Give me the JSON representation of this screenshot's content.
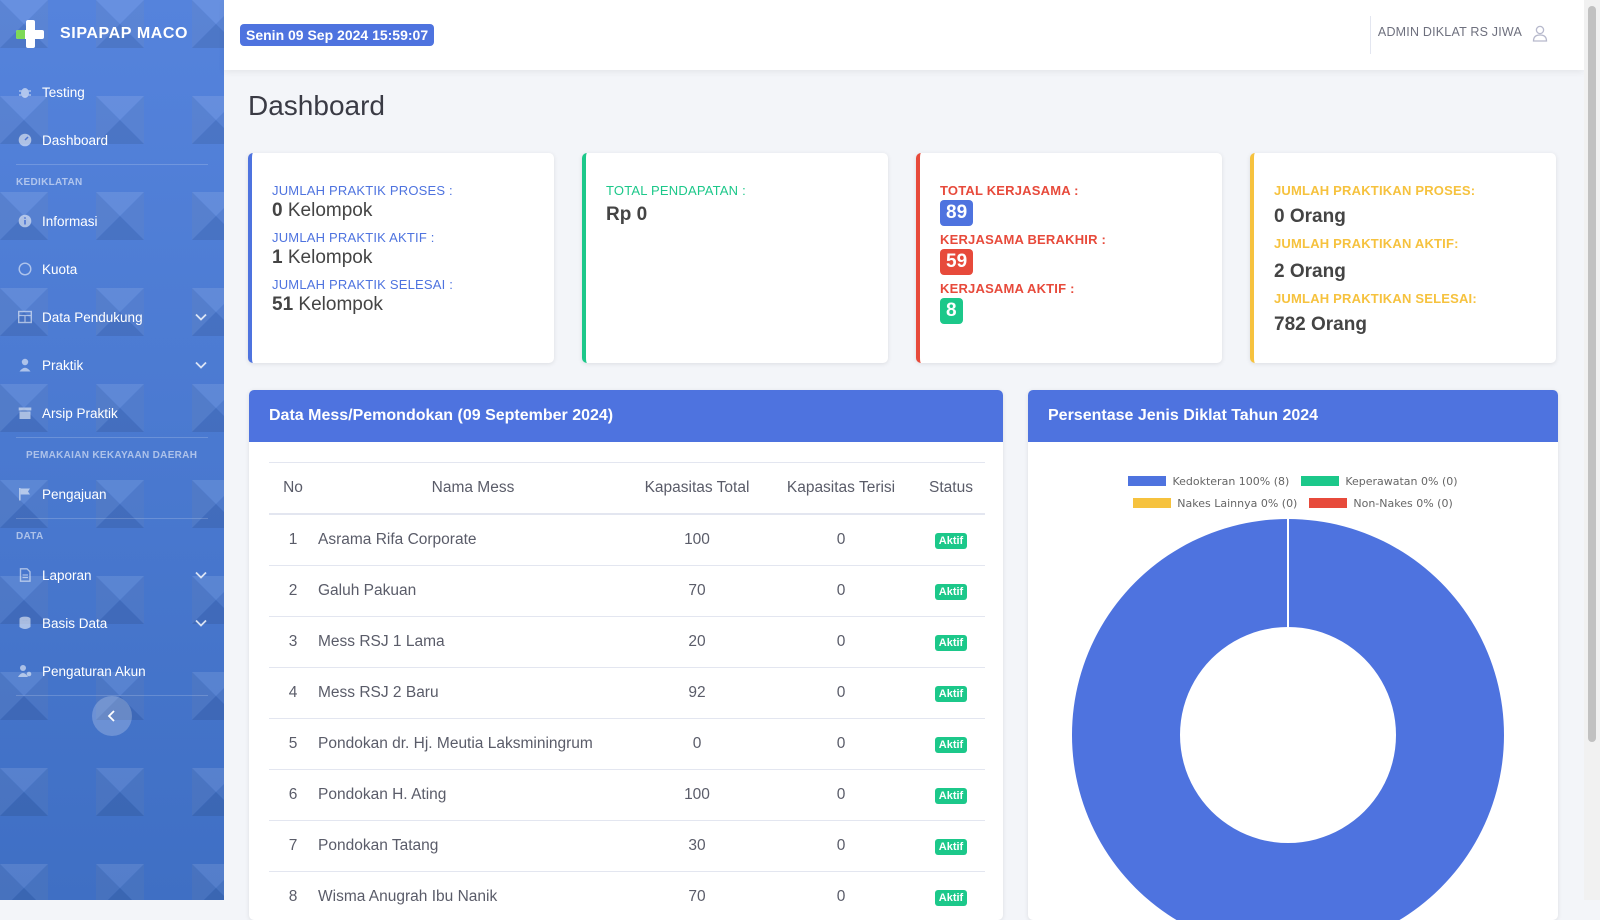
{
  "brand": {
    "name": "SIPAPAP MACO"
  },
  "sidebar": {
    "items": [
      {
        "label": "Testing"
      },
      {
        "label": "Dashboard"
      },
      {
        "label": "Informasi"
      },
      {
        "label": "Kuota"
      },
      {
        "label": "Data Pendukung"
      },
      {
        "label": "Praktik"
      },
      {
        "label": "Arsip Praktik"
      },
      {
        "label": "Pengajuan"
      },
      {
        "label": "Laporan"
      },
      {
        "label": "Basis Data"
      },
      {
        "label": "Pengaturan Akun"
      }
    ],
    "headings": {
      "kediklatan": "KEDIKLATAN",
      "pemakaian": "PEMAKAIAN KEKAYAAN DAERAH",
      "data": "DATA"
    }
  },
  "topbar": {
    "datetime": "Senin 09 Sep 2024 15:59:07",
    "user": "ADMIN DIKLAT RS JIWA"
  },
  "page": {
    "title": "Dashboard"
  },
  "cards": {
    "praktik": {
      "proses_label": "JUMLAH PRAKTIK PROSES :",
      "proses_num": "0",
      "proses_unit": " Kelompok",
      "aktif_label": "JUMLAH PRAKTIK AKTIF :",
      "aktif_num": "1",
      "aktif_unit": " Kelompok",
      "selesai_label": "JUMLAH PRAKTIK SELESAI :",
      "selesai_num": "51",
      "selesai_unit": " Kelompok"
    },
    "pendapatan": {
      "label": "TOTAL PENDAPATAN :",
      "value": "Rp 0"
    },
    "kerjasama": {
      "total_label": "TOTAL KERJASAMA :",
      "total": "89",
      "berakhir_label": "KERJASAMA BERAKHIR :",
      "berakhir": "59",
      "aktif_label": "KERJASAMA AKTIF :",
      "aktif": "8"
    },
    "praktikan": {
      "proses_label": "JUMLAH PRAKTIKAN PROSES:",
      "proses": "0 Orang",
      "aktif_label": "JUMLAH PRAKTIKAN AKTIF:",
      "aktif": "2 Orang",
      "selesai_label": "JUMLAH PRAKTIKAN SELESAI:",
      "selesai": "782 Orang"
    }
  },
  "mess": {
    "title": "Data Mess/Pemondokan (09 September 2024)",
    "columns": [
      "No",
      "Nama Mess",
      "Kapasitas Total",
      "Kapasitas Terisi",
      "Status"
    ],
    "rows": [
      {
        "no": "1",
        "name": "Asrama Rifa Corporate",
        "total": "100",
        "terisi": "0",
        "status": "Aktif"
      },
      {
        "no": "2",
        "name": "Galuh Pakuan",
        "total": "70",
        "terisi": "0",
        "status": "Aktif"
      },
      {
        "no": "3",
        "name": "Mess RSJ 1 Lama",
        "total": "20",
        "terisi": "0",
        "status": "Aktif"
      },
      {
        "no": "4",
        "name": "Mess RSJ 2 Baru",
        "total": "92",
        "terisi": "0",
        "status": "Aktif"
      },
      {
        "no": "5",
        "name": "Pondokan dr. Hj. Meutia Laksminingrum",
        "total": "0",
        "terisi": "0",
        "status": "Aktif"
      },
      {
        "no": "6",
        "name": "Pondokan H. Ating",
        "total": "100",
        "terisi": "0",
        "status": "Aktif"
      },
      {
        "no": "7",
        "name": "Pondokan Tatang",
        "total": "30",
        "terisi": "0",
        "status": "Aktif"
      },
      {
        "no": "8",
        "name": "Wisma Anugrah Ibu Nanik",
        "total": "70",
        "terisi": "0",
        "status": "Aktif"
      }
    ]
  },
  "diklat": {
    "title": "Persentase Jenis Diklat Tahun 2024",
    "legend": [
      {
        "label": "Kedokteran 100% (8)",
        "color": "#4e73df"
      },
      {
        "label": "Keperawatan 0% (0)",
        "color": "#1cc88a"
      },
      {
        "label": "Nakes Lainnya 0% (0)",
        "color": "#f6c23e"
      },
      {
        "label": "Non-Nakes 0% (0)",
        "color": "#e74a3b"
      }
    ]
  },
  "chart_data": {
    "type": "pie",
    "variant": "doughnut",
    "title": "Persentase Jenis Diklat Tahun 2024",
    "categories": [
      "Kedokteran",
      "Keperawatan",
      "Nakes Lainnya",
      "Non-Nakes"
    ],
    "values": [
      8,
      0,
      0,
      0
    ],
    "percent": [
      100,
      0,
      0,
      0
    ],
    "colors": [
      "#4e73df",
      "#1cc88a",
      "#f6c23e",
      "#e74a3b"
    ],
    "legend": "top"
  }
}
